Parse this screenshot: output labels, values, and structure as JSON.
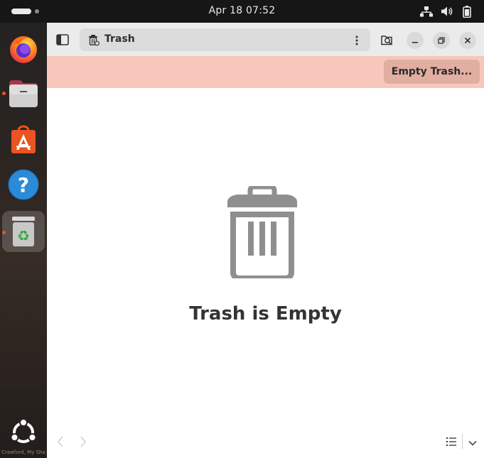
{
  "topbar": {
    "clock": "Apr 18  07:52",
    "icons": [
      "activities-pill",
      "network-icon",
      "volume-icon",
      "battery-icon"
    ]
  },
  "dock": {
    "items": [
      {
        "name": "firefox",
        "running": false
      },
      {
        "name": "files",
        "running": true
      },
      {
        "name": "app-center",
        "running": false
      },
      {
        "name": "help",
        "running": false
      },
      {
        "name": "trash",
        "running": true,
        "active": true
      }
    ],
    "watermark": "Crawford, My Sha",
    "accent": "#e95420"
  },
  "headerbar": {
    "location": "Trash"
  },
  "infobar": {
    "button": "Empty Trash..."
  },
  "content": {
    "title": "Trash is Empty"
  },
  "colors": {
    "infobar_bg": "#f6c7ba",
    "infobar_button": "#e2aea2",
    "headerbar_bg": "#ebebeb",
    "icon_gray": "#8f8f8f"
  }
}
